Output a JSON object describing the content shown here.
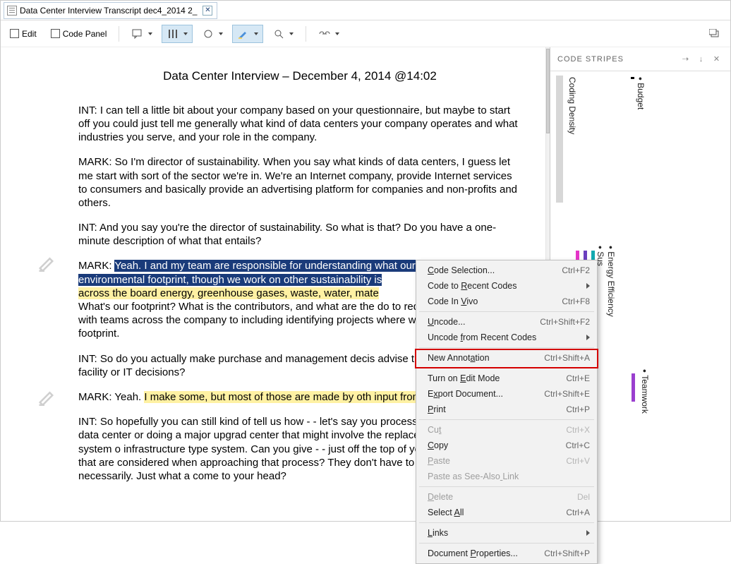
{
  "tab": {
    "title": "Data Center Interview Transcript dec4_2014 2_"
  },
  "toolbar": {
    "edit": "Edit",
    "codepanel": "Code Panel"
  },
  "doc": {
    "title": "Data Center Interview – December 4, 2014 @14:02",
    "p1": "INT:  I can tell a little bit about your company based on your questionnaire, but maybe to start off you could just tell me generally what kind of data centers your company operates and what industries you serve, and your role in the company.",
    "p2": "MARK:  So I'm director of sustainability.  When you say what kinds of data centers, I guess let me start with sort of the sector we're in.  We're an Internet company, provide Internet services to consumers and basically provide an advertising platform for companies and non-profits and others.",
    "p3": "INT:  And you say you're the director of sustainability.  So what is that?  Do you have a one-minute description of what that entails?",
    "p4_pre": "MARK: ",
    "p4_sel": "Yeah.  I and my team are responsible for understanding what our particularly environmental footprint, though we work on other sustainability is",
    "p4_yel": "across the board energy, greenhouse gases, waste, water, mate",
    "p4_post": "What's our footprint?  What is the contributors, and what are the do to reduce it?  And we work with teams across the company to including identifying projects where we can reduce our footprint.",
    "p5": "INT:  So do you actually make purchase and management decis advise the folks who make the facility or IT decisions?",
    "p6_pre": "MARK:  Yeah.  ",
    "p6_yel": "I make some, but most of those are made by oth input from me and my team.",
    "p7": "INT:  So hopefully you can still kind of tell us how - - let's say you process of setting up a new data center or doing a major upgrad center that might involve the replacement of a major IT system o infrastructure type system.  Can you give - - just off the top of yo the top three factors that are considered when approaching that process?  They don't have to be ranked necessarily.  Just what a come to your head?"
  },
  "stripesPanel": {
    "title": "CODE STRIPES",
    "codes": {
      "density": "Coding Density",
      "budget": "Budget",
      "sus": "Sus",
      "energy": "Energy Efficiency",
      "teamwork": "Teamwork"
    }
  },
  "ctx": [
    {
      "t": "item",
      "label": "Code Selection...",
      "sc": "Ctrl+F2",
      "acc": 0
    },
    {
      "t": "item",
      "label": "Code to Recent Codes",
      "sub": true,
      "acc": 8
    },
    {
      "t": "item",
      "label": "Code In Vivo",
      "sc": "Ctrl+F8",
      "acc": 8
    },
    {
      "t": "sep"
    },
    {
      "t": "item",
      "label": "Uncode...",
      "sc": "Ctrl+Shift+F2",
      "acc": 0
    },
    {
      "t": "item",
      "label": "Uncode from Recent Codes",
      "sub": true,
      "acc": 7
    },
    {
      "t": "sep"
    },
    {
      "t": "item",
      "label": "New Annotation",
      "sc": "Ctrl+Shift+A",
      "acc": 9,
      "hl": true
    },
    {
      "t": "sep"
    },
    {
      "t": "item",
      "label": "Turn on Edit Mode",
      "sc": "Ctrl+E",
      "acc": 8
    },
    {
      "t": "item",
      "label": "Export Document...",
      "sc": "Ctrl+Shift+E",
      "acc": 1
    },
    {
      "t": "item",
      "label": "Print",
      "sc": "Ctrl+P",
      "acc": 0
    },
    {
      "t": "sep"
    },
    {
      "t": "item",
      "label": "Cut",
      "sc": "Ctrl+X",
      "dis": true,
      "acc": 2
    },
    {
      "t": "item",
      "label": "Copy",
      "sc": "Ctrl+C",
      "acc": 0
    },
    {
      "t": "item",
      "label": "Paste",
      "sc": "Ctrl+V",
      "dis": true,
      "acc": 0
    },
    {
      "t": "item",
      "label": "Paste as See-Also Link",
      "dis": true,
      "acc": 17
    },
    {
      "t": "sep"
    },
    {
      "t": "item",
      "label": "Delete",
      "sc": "Del",
      "dis": true,
      "acc": 0
    },
    {
      "t": "item",
      "label": "Select All",
      "sc": "Ctrl+A",
      "acc": 7
    },
    {
      "t": "sep"
    },
    {
      "t": "item",
      "label": "Links",
      "sub": true,
      "acc": 0
    },
    {
      "t": "sep"
    },
    {
      "t": "item",
      "label": "Document Properties...",
      "sc": "Ctrl+Shift+P",
      "acc": 9
    }
  ]
}
